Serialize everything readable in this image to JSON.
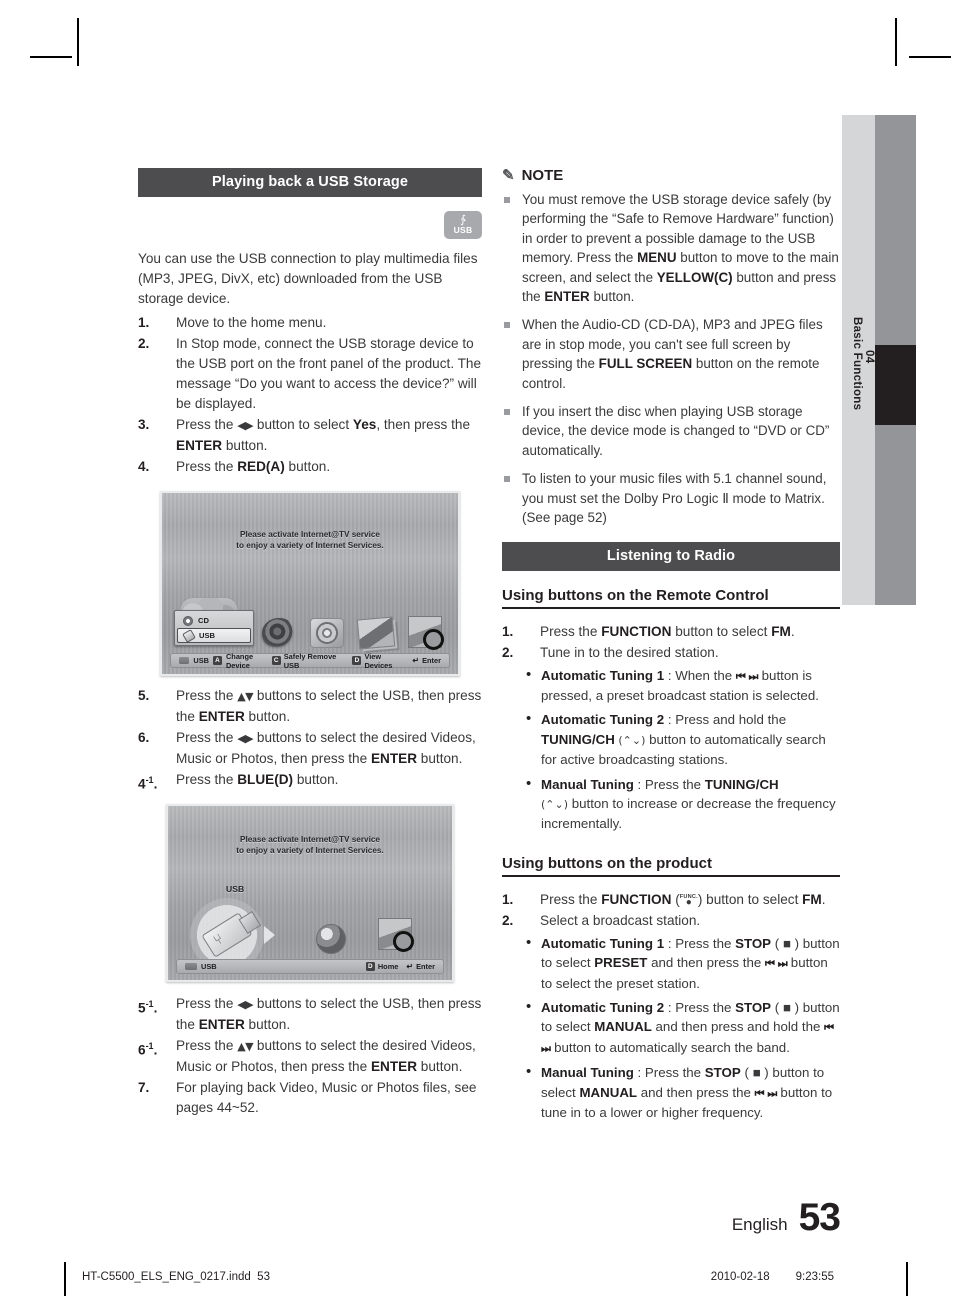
{
  "thumb_tab": {
    "chapter_num": "04",
    "chapter_title": "Basic Functions"
  },
  "left_column": {
    "section_title": "Playing back a USB Storage",
    "usb_badge_label": "USB",
    "intro": "You can use the USB connection to play multimedia files (MP3, JPEG, DivX, etc) downloaded from the USB storage device.",
    "steps": [
      {
        "num": "1.",
        "text": "Move to the home menu."
      },
      {
        "num": "2.",
        "text": "In Stop mode, connect the USB storage device to the USB port on the front panel of the product. The message “Do you want to access the device?” will be displayed."
      },
      {
        "num": "3.",
        "text_a": "Press the ",
        "nav": "◀▶",
        "text_b": " button to select ",
        "bold_a": "Yes",
        "text_c": ", then press the ",
        "bold_b": "ENTER",
        "text_d": " button."
      },
      {
        "num": "4.",
        "text_a": "Press the ",
        "bold_a": "RED(A)",
        "text_b": " button."
      }
    ],
    "screenshot_1": {
      "message_line1": "Please activate Internet@TV service",
      "message_line2": "to enjoy a variety of Internet Services.",
      "dropdown": [
        {
          "label": "CD",
          "selected": false
        },
        {
          "label": "USB",
          "selected": true
        }
      ],
      "bottom_bar": {
        "device_label": "USB",
        "items": [
          {
            "key": "A",
            "label": "Change Device"
          },
          {
            "key": "C",
            "label": "Safely Remove USB"
          },
          {
            "key": "D",
            "label": "View Devices"
          }
        ],
        "enter_label": "Enter"
      }
    },
    "steps_mid": [
      {
        "num": "5.",
        "text_a": "Press the ",
        "nav": "▲▼",
        "text_b": " buttons to select the USB, then press the ",
        "bold_a": "ENTER",
        "text_c": " button."
      },
      {
        "num": "6.",
        "text_a": "Press the ",
        "nav": "◀▶",
        "text_b": " buttons to select the desired Videos, Music or Photos, then press the ",
        "bold_a": "ENTER",
        "text_c": " button."
      },
      {
        "num": "4",
        "sup": "-1",
        "dot": ".",
        "text_a": "Press the ",
        "bold_a": "BLUE(D)",
        "text_b": " button."
      }
    ],
    "screenshot_2": {
      "message_line1": "Please activate Internet@TV service",
      "message_line2": "to enjoy a variety of Internet Services.",
      "usb_label": "USB",
      "bottom_bar": {
        "device_label": "USB",
        "home_key": "D",
        "home_label": "Home",
        "enter_label": "Enter"
      }
    },
    "steps_end": [
      {
        "num": "5",
        "sup": "-1",
        "dot": ".",
        "text_a": "Press the ",
        "nav": "◀▶",
        "text_b": " buttons to select the USB, then press the ",
        "bold_a": "ENTER",
        "text_c": " button."
      },
      {
        "num": "6",
        "sup": "-1",
        "dot": ".",
        "text_a": "Press the ",
        "nav": "▲▼",
        "text_b": " buttons to select the desired Videos, Music or Photos, then press the ",
        "bold_a": "ENTER",
        "text_c": " button."
      },
      {
        "num": "7.",
        "text": "For playing back Video, Music or Photos files, see pages 44~52."
      }
    ]
  },
  "right_column": {
    "note_heading": "NOTE",
    "notes": [
      {
        "a": "You must remove the USB storage device safely (by performing the “Safe to Remove Hardware” function) in order to prevent a possible damage to the USB memory. Press the ",
        "b1": "MENU",
        "c": " button to move to the main screen, and select the ",
        "b2": "YELLOW(C)",
        "d": " button and press the ",
        "b3": "ENTER",
        "e": " button."
      },
      {
        "a": "When the Audio-CD (CD-DA), MP3 and JPEG files are in stop mode, you can't see full screen by pressing the ",
        "b1": "FULL SCREEN",
        "c": " button on the remote control."
      },
      {
        "a": "If you insert the disc when playing USB storage device, the device mode is changed to “DVD or CD” automatically."
      },
      {
        "a": "To listen to your music files with 5.1 channel sound, you must set the Dolby Pro Logic Ⅱ mode to Matrix. (See page 52)"
      }
    ],
    "section_title": "Listening to Radio",
    "subhead_remote": "Using buttons on the Remote Control",
    "remote_steps": [
      {
        "num": "1.",
        "a": "Press the ",
        "b1": "FUNCTION",
        "c": " button to select ",
        "b2": "FM",
        "d": "."
      },
      {
        "num": "2.",
        "a": "Tune in to the desired station."
      }
    ],
    "remote_bullets": [
      {
        "title": "Automatic Tuning 1",
        "a": " : When the ",
        "nav": "⏮ ⏭",
        "b": " button is pressed, a preset broadcast station is selected."
      },
      {
        "title": "Automatic Tuning 2",
        "a": " : Press and hold the ",
        "bold": "TUNING/CH",
        "caret": " (⌃⌄)",
        "b": " button to automatically search for active broadcasting stations."
      },
      {
        "title": "Manual Tuning",
        "a": " : Press the ",
        "bold": "TUNING/CH",
        "caret": "(⌃⌄)",
        "b": " button to increase or decrease the frequency incrementally."
      }
    ],
    "subhead_product": "Using buttons on the product",
    "product_steps": [
      {
        "num": "1.",
        "a": "Press the ",
        "b1": "FUNCTION",
        "func_top": "FUNC.",
        "func_dot": "●",
        "c": " button to select ",
        "b2": "FM",
        "d": "."
      },
      {
        "num": "2.",
        "a": "Select a broadcast station."
      }
    ],
    "product_bullets": [
      {
        "title": "Automatic Tuning 1",
        "a": " : Press the ",
        "bold1": "STOP",
        "stop": " ( ■ )",
        "b": " button to select ",
        "bold2": "PRESET",
        "c": " and then press the ",
        "nav": "⏮ ⏭",
        "d": " button to select the preset station."
      },
      {
        "title": "Automatic Tuning 2",
        "a": " : Press the ",
        "bold1": "STOP",
        "stop": " ( ■ )",
        "b": " button to select ",
        "bold2": "MANUAL",
        "c": " and then press and hold the ",
        "nav": "⏮ ⏭",
        "d": " button to automatically search the band."
      },
      {
        "title": "Manual Tuning",
        "a": " : Press the ",
        "bold1": "STOP",
        "stop": " ( ■ )",
        "b": " button to select ",
        "bold2": "MANUAL",
        "c": " and then press the ",
        "nav": "⏮ ⏭",
        "d": " button to tune in to a lower or higher frequency."
      }
    ]
  },
  "page_footer": {
    "language": "English",
    "page_number": "53",
    "file_name": "HT-C5500_ELS_ENG_0217.indd",
    "file_page": "53",
    "date": "2010-02-18",
    "time": "9:23:55"
  }
}
